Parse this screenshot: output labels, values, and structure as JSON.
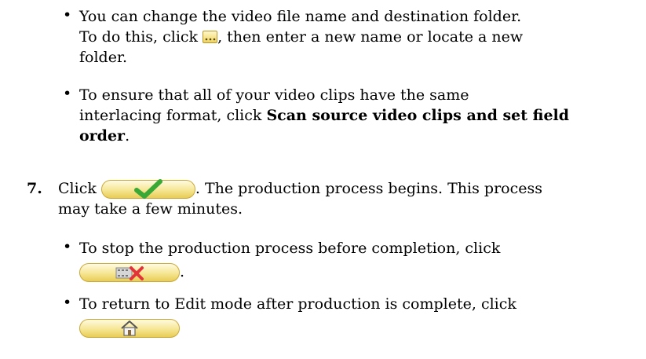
{
  "items": {
    "b1": {
      "bullet": "•",
      "l1": "You can change the video file name and destination folder.",
      "l2_a": "To do this, click ",
      "l2_b": ", then enter a new name or locate a new",
      "l3": "folder."
    },
    "b2": {
      "bullet": "•",
      "l1": "To ensure that all of your video clips have the same",
      "l2_a": "interlacing format, click ",
      "l2_bold": "Scan source video clips and set field",
      "l3_bold": "order",
      "l3_tail": "."
    },
    "step7": {
      "number": "7.",
      "l1_a": "Click ",
      "l1_b": ". The production process begins. This process",
      "l2": "may take a few minutes."
    },
    "b3": {
      "bullet": "•",
      "l1": "To stop the production process before completion, click",
      "l2_tail": "."
    },
    "b4": {
      "bullet": "•",
      "l1": "To return to Edit mode after production is complete, click"
    }
  },
  "icons": {
    "browse": "ellipsis-browse-icon",
    "produce": "green-checkmark-icon",
    "stop": "filmstrip-x-icon",
    "home": "house-icon"
  },
  "colors": {
    "button_fill": "#f6e693",
    "button_border": "#c9a93a",
    "check_green": "#3aa835",
    "x_red": "#e2333a"
  }
}
